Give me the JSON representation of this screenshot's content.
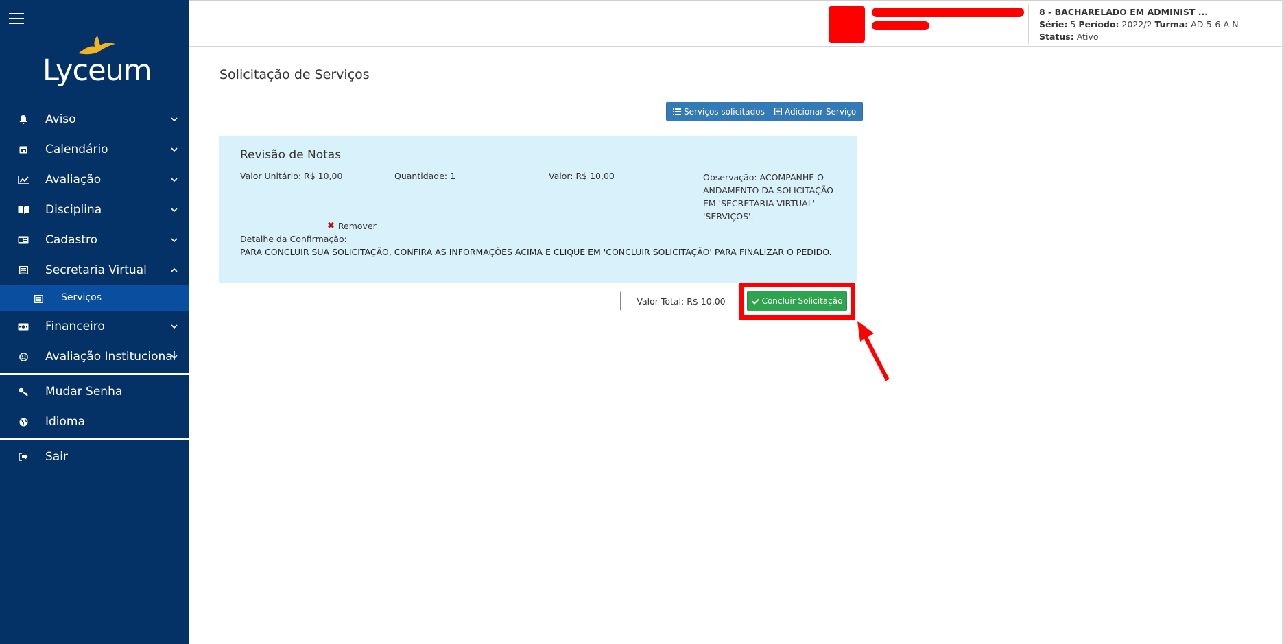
{
  "sidebar": {
    "logo_text": "Lyceum",
    "items": [
      {
        "label": "Aviso",
        "icon": "bell-icon"
      },
      {
        "label": "Calendário",
        "icon": "calendar-icon"
      },
      {
        "label": "Avaliação",
        "icon": "chart-line-icon"
      },
      {
        "label": "Disciplina",
        "icon": "book-open-icon"
      },
      {
        "label": "Cadastro",
        "icon": "id-card-icon"
      },
      {
        "label": "Secretaria Virtual",
        "icon": "newspaper-icon"
      }
    ],
    "subitem": {
      "label": "Serviços",
      "icon": "newspaper-icon"
    },
    "items_after": [
      {
        "label": "Financeiro",
        "icon": "money-icon"
      },
      {
        "label": "Avaliação Institucional",
        "icon": "smile-icon"
      }
    ],
    "group2": [
      {
        "label": "Mudar Senha",
        "icon": "key-icon"
      },
      {
        "label": "Idioma",
        "icon": "globe-icon"
      }
    ],
    "logout": {
      "label": "Sair",
      "icon": "sign-out-icon"
    }
  },
  "header": {
    "course": "8 - BACHARELADO EM ADMINIST ...",
    "serie_label": "Série:",
    "serie_value": "5",
    "periodo_label": "Período:",
    "periodo_value": "2022/2",
    "turma_label": "Turma:",
    "turma_value": "AD-5-6-A-N",
    "status_label": "Status:",
    "status_value": "Ativo"
  },
  "main": {
    "title": "Solicitação de Serviços",
    "btn_solicitados": "Serviços solicitados",
    "btn_adicionar": "Adicionar Serviço",
    "card": {
      "title": "Revisão de Notas",
      "valor_unitario": "Valor Unitário: R$ 10,00",
      "quantidade": "Quantidade: 1",
      "valor": "Valor: R$ 10,00",
      "observacao": "Observação: ACOMPANHE O ANDAMENTO DA SOLICITAÇÃO EM 'SECRETARIA VIRTUAL' - 'SERVIÇOS'.",
      "remover": "Remover",
      "detalhe_label": "Detalhe da Confirmação:",
      "detalhe_text": "PARA CONCLUIR SUA SOLICITAÇÃO, CONFIRA AS INFORMAÇÕES ACIMA E CLIQUE EM 'CONCLUIR SOLICITAÇÃO' PARA FINALIZAR O PEDIDO."
    },
    "valor_total": "Valor Total: R$ 10,00",
    "btn_concluir": "Concluir Solicitação"
  },
  "colors": {
    "sidebar_bg": "#043266",
    "sidebar_active": "#0a4ea0",
    "btn_blue": "#337ab7",
    "btn_green": "#2fa44f",
    "card_bg": "#d9f1fb",
    "highlight": "#ff0000"
  }
}
